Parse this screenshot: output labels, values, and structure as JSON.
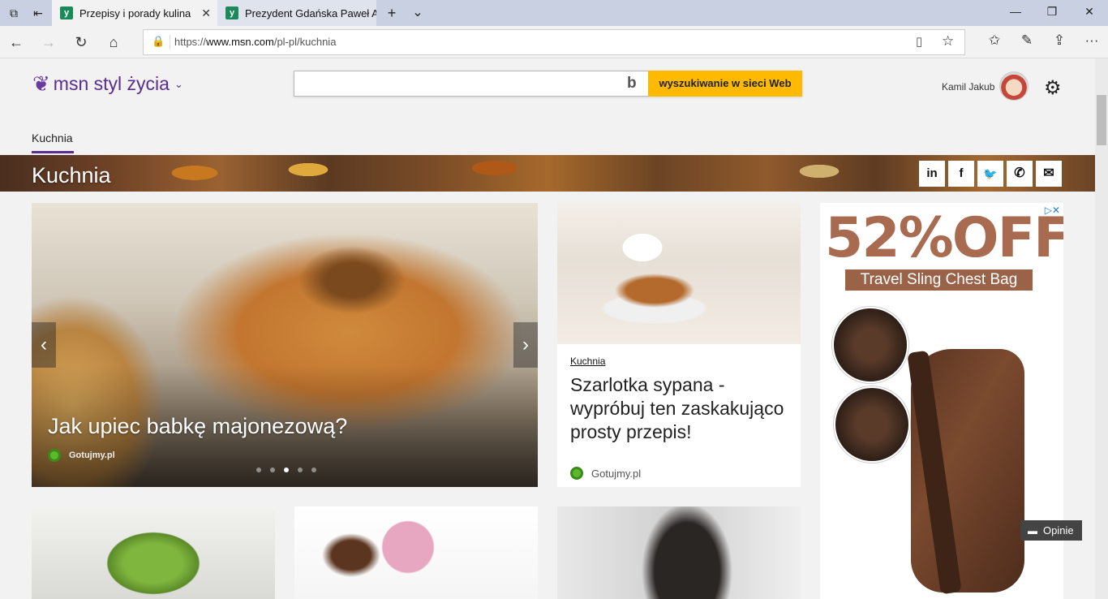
{
  "browser": {
    "tabs": [
      {
        "title": "Przepisy i porady kulina",
        "active": true
      },
      {
        "title": "Prezydent Gdańska Paweł A",
        "active": false
      }
    ],
    "url_prefix": "https://",
    "url_domain": "www.msn.com",
    "url_path": "/pl-pl/kuchnia",
    "icons": {
      "tab_actions": "tab-actions-icon",
      "back_tabs": "set-aside-tabs-icon",
      "new_tab": "+",
      "tab_list": "⌄",
      "minimize": "—",
      "restore": "❐",
      "close": "✕",
      "back": "←",
      "forward": "→",
      "refresh": "↻",
      "home": "⌂",
      "reading_view": "▯",
      "favorite": "☆",
      "favorites_hub": "☆≡",
      "notes": "✎",
      "share": "⇪",
      "more": "···",
      "lock": "🔒"
    }
  },
  "header": {
    "logo_text": "msn styl życia",
    "search_placeholder": "",
    "search_button": "wyszukiwanie w sieci Web",
    "bing_mark": "b",
    "user_name": "Kamil Jakub",
    "settings_icon": "⚙"
  },
  "subnav": {
    "active_item": "Kuchnia"
  },
  "banner": {
    "title": "Kuchnia",
    "share": [
      {
        "name": "linkedin",
        "glyph": "in"
      },
      {
        "name": "facebook",
        "glyph": "f"
      },
      {
        "name": "twitter",
        "glyph": "🐦"
      },
      {
        "name": "whatsapp",
        "glyph": "✆"
      },
      {
        "name": "email",
        "glyph": "✉"
      }
    ]
  },
  "hero": {
    "title": "Jak upiec babkę majonezową?",
    "source": "Gotujmy.pl",
    "prev": "‹",
    "next": "›",
    "slide_count": 5,
    "active_slide": 3
  },
  "card": {
    "category": "Kuchnia",
    "title": "Szarlotka sypana - wypróbuj ten zaskakująco prosty przepis!",
    "source": "Gotujmy.pl"
  },
  "ad": {
    "headline": "52%OFF",
    "subtitle": "Travel Sling Chest Bag",
    "ad_choices": "▷✕"
  },
  "feedback": {
    "label": "Opinie",
    "icon": "▬"
  },
  "colors": {
    "msn_purple": "#5c2d91",
    "search_yellow": "#ffb900",
    "source_green": "#5cb82c",
    "ad_brown": "#a86b4f"
  }
}
